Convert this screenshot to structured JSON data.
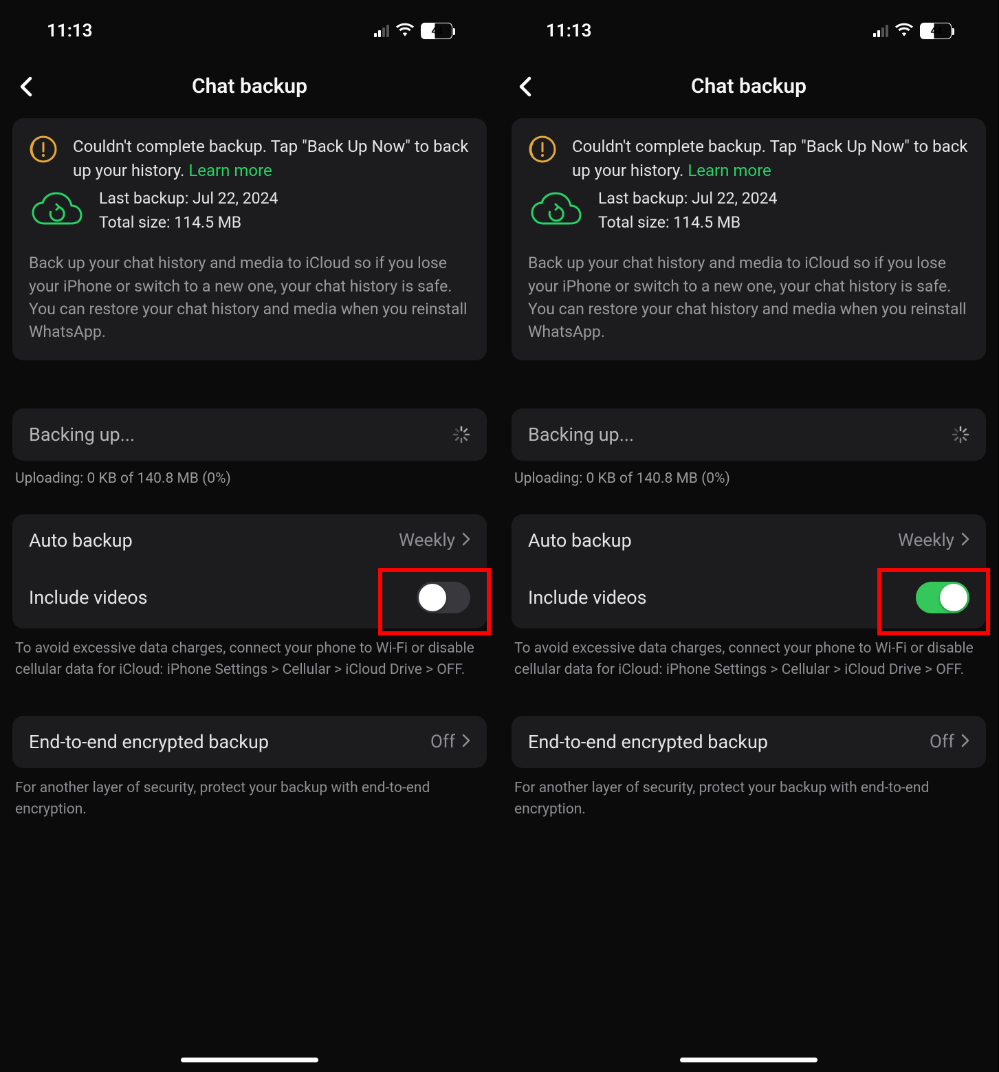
{
  "status_bar": {
    "time": "11:13",
    "battery_pct": "44"
  },
  "header": {
    "title": "Chat backup"
  },
  "alert": {
    "text_prefix": "Couldn't complete backup. Tap \"Back Up Now\" to back up your history. ",
    "learn_more": "Learn more"
  },
  "backup_status": {
    "last_backup": "Last backup: Jul 22, 2024",
    "total_size": "Total size: 114.5 MB"
  },
  "info_description": "Back up your chat history and media to iCloud so if you lose your iPhone or switch to a new one, your chat history is safe. You can restore your chat history and media when you reinstall WhatsApp.",
  "backing_up": {
    "label": "Backing up...",
    "uploading": "Uploading: 0 KB of 140.8 MB (0%)"
  },
  "settings": {
    "auto_backup_label": "Auto backup",
    "auto_backup_value": "Weekly",
    "include_videos_label": "Include videos",
    "footer": "To avoid excessive data charges, connect your phone to Wi-Fi or disable cellular data for iCloud: iPhone Settings > Cellular > iCloud Drive > OFF."
  },
  "e2e": {
    "label": "End-to-end encrypted backup",
    "value": "Off",
    "footer": "For another layer of security, protect your backup with end-to-end encryption."
  },
  "panels": [
    {
      "include_videos_on": false
    },
    {
      "include_videos_on": true
    }
  ]
}
